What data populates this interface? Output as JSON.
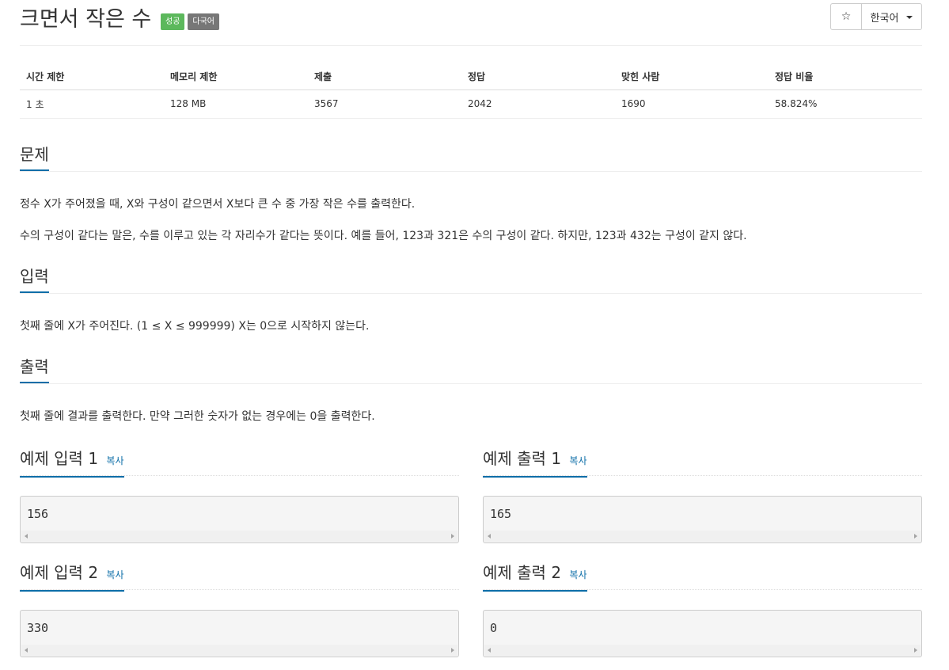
{
  "header": {
    "title": "크면서 작은 수",
    "badge_success": "성공",
    "badge_lang": "다국어",
    "star_icon": "☆",
    "lang_select": "한국어"
  },
  "info": {
    "headers": [
      "시간 제한",
      "메모리 제한",
      "제출",
      "정답",
      "맞힌 사람",
      "정답 비율"
    ],
    "values": [
      "1 초",
      "128 MB",
      "3567",
      "2042",
      "1690",
      "58.824%"
    ]
  },
  "problem": {
    "heading": "문제",
    "p1": "정수 X가 주어졌을 때, X와 구성이 같으면서 X보다 큰 수 중 가장 작은 수를 출력한다.",
    "p2": "수의 구성이 같다는 말은, 수를 이루고 있는 각 자리수가 같다는 뜻이다. 예를 들어, 123과 321은 수의 구성이 같다. 하지만, 123과 432는 구성이 같지 않다."
  },
  "input": {
    "heading": "입력",
    "p1": "첫째 줄에 X가 주어진다. (1 ≤ X ≤ 999999) X는 0으로 시작하지 않는다."
  },
  "output": {
    "heading": "출력",
    "p1": "첫째 줄에 결과를 출력한다. 만약 그러한 숫자가 없는 경우에는 0을 출력한다."
  },
  "samples": {
    "copy_label": "복사",
    "in1_title": "예제 입력 1",
    "out1_title": "예제 출력 1",
    "in2_title": "예제 입력 2",
    "out2_title": "예제 출력 2",
    "in1": "156",
    "out1": "165",
    "in2": "330",
    "out2": "0"
  }
}
